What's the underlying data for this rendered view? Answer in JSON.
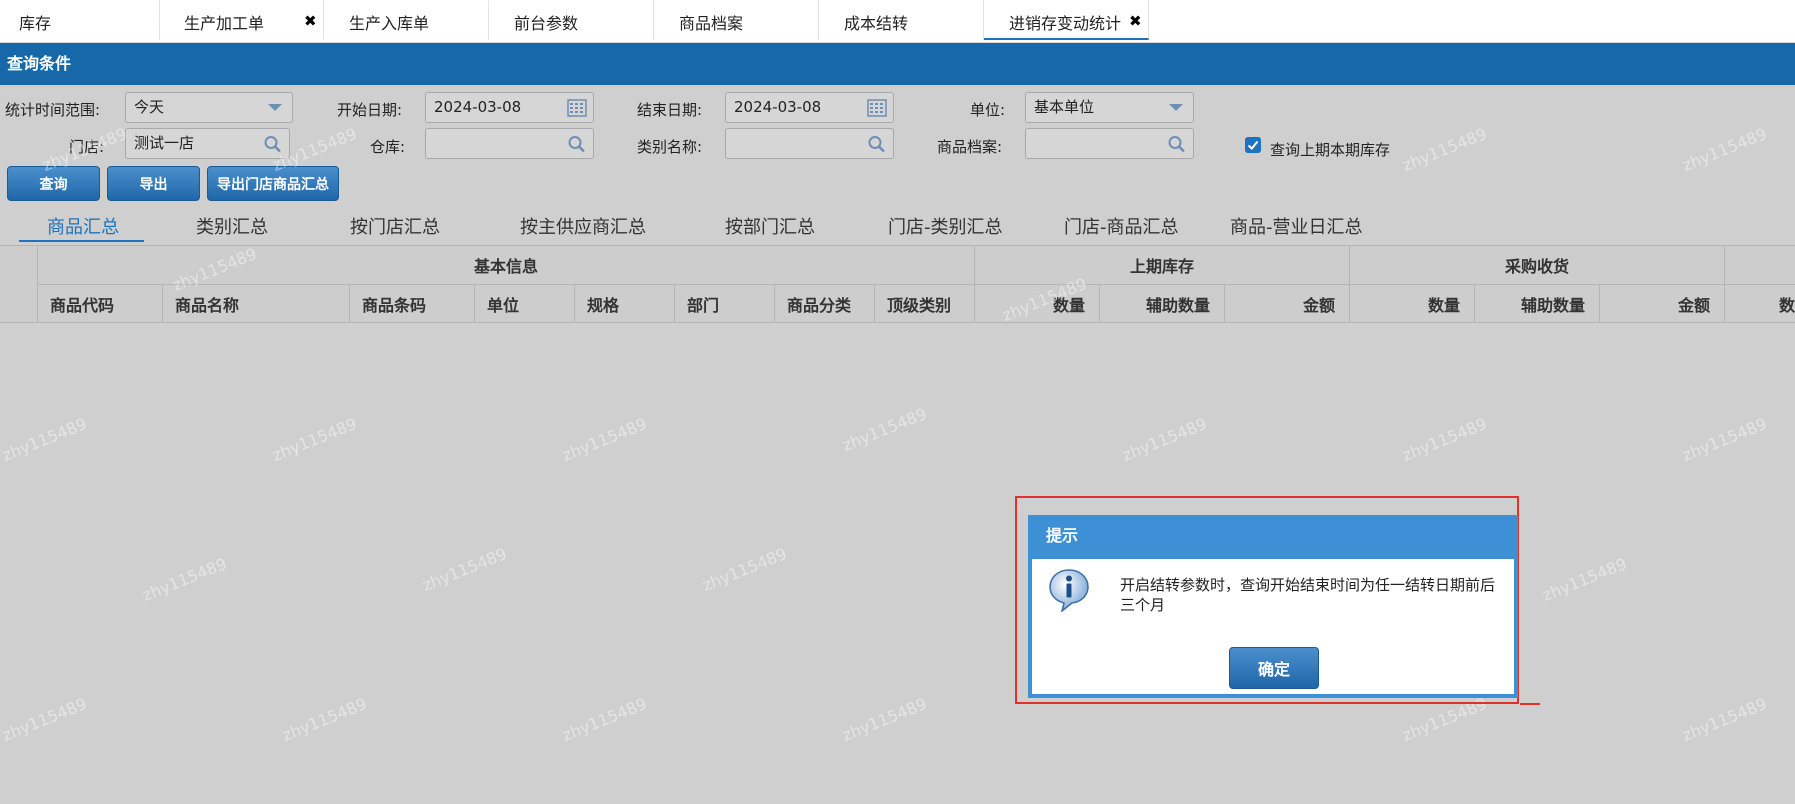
{
  "tabs": [
    {
      "label": "库存",
      "closable": false
    },
    {
      "label": "生产加工单",
      "closable": true
    },
    {
      "label": "生产入库单",
      "closable": false
    },
    {
      "label": "前台参数",
      "closable": false
    },
    {
      "label": "商品档案",
      "closable": false
    },
    {
      "label": "成本结转",
      "closable": false
    },
    {
      "label": "进销存变动统计",
      "closable": true,
      "active": true
    }
  ],
  "close_glyph": "✖",
  "header": {
    "title": "查询条件"
  },
  "form": {
    "range_label": "统计时间范围:",
    "range_value": "今天",
    "start_label": "开始日期:",
    "start_value": "2024-03-08",
    "end_label": "结束日期:",
    "end_value": "2024-03-08",
    "unit_label": "单位:",
    "unit_value": "基本单位",
    "store_label": "门店:",
    "store_value": "测试一店",
    "warehouse_label": "仓库:",
    "warehouse_value": "",
    "category_label": "类别名称:",
    "category_value": "",
    "product_label": "商品档案:",
    "product_value": "",
    "checkbox_label": "查询上期本期库存",
    "checkbox_checked": true
  },
  "buttons": {
    "query": "查询",
    "export": "导出",
    "export_store": "导出门店商品汇总"
  },
  "subtabs": [
    "商品汇总",
    "类别汇总",
    "按门店汇总",
    "按主供应商汇总",
    "按部门汇总",
    "门店-类别汇总",
    "门店-商品汇总",
    "商品-营业日汇总"
  ],
  "grid": {
    "groups": {
      "basic": "基本信息",
      "prev_stock": "上期库存",
      "purchase": "采购收货"
    },
    "basic_columns": [
      "商品代码",
      "商品名称",
      "商品条码",
      "单位",
      "规格",
      "部门",
      "商品分类",
      "顶级类别"
    ],
    "prev_columns": [
      "数量",
      "辅助数量",
      "金额"
    ],
    "purchase_columns": [
      "数量",
      "辅助数量",
      "金额"
    ],
    "trailing_fragment": "数"
  },
  "watermark": "zhy115489",
  "dialog": {
    "title": "提示",
    "message": "开启结转参数时，查询开始结束时间为任一结转日期前后三个月",
    "ok": "确定"
  },
  "colors": {
    "accent": "#1668a8",
    "dialog": "#3d8fd6",
    "highlight": "#e0322b"
  }
}
